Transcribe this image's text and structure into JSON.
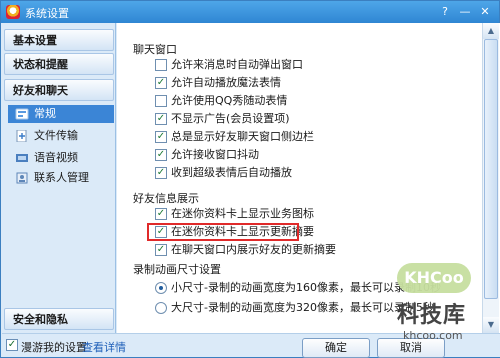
{
  "window": {
    "title": "系统设置"
  },
  "titlebar_buttons": {
    "help": "?",
    "minimize": "—",
    "close": "✕"
  },
  "sidebar": {
    "groups": [
      "基本设置",
      "状态和提醒",
      "好友和聊天",
      "安全和隐私"
    ],
    "items": [
      {
        "label": "常规",
        "icon": "gear-icon",
        "active": true
      },
      {
        "label": "文件传输",
        "icon": "file-transfer-icon",
        "active": false
      },
      {
        "label": "语音视频",
        "icon": "video-icon",
        "active": false
      },
      {
        "label": "联系人管理",
        "icon": "contacts-icon",
        "active": false
      }
    ]
  },
  "content": {
    "sections": [
      {
        "title": "聊天窗口",
        "options": [
          {
            "label": "允许来消息时自动弹出窗口",
            "checked": false
          },
          {
            "label": "允许自动播放魔法表情",
            "checked": true
          },
          {
            "label": "允许使用QQ秀随动表情",
            "checked": false
          },
          {
            "label": "不显示广告(会员设置项)",
            "checked": true
          },
          {
            "label": "总是显示好友聊天窗口侧边栏",
            "checked": true
          },
          {
            "label": "允许接收窗口抖动",
            "checked": true
          },
          {
            "label": "收到超级表情后自动播放",
            "checked": true
          }
        ]
      },
      {
        "title": "好友信息展示",
        "options": [
          {
            "label": "在迷你资料卡上显示业务图标",
            "checked": true
          },
          {
            "label": "在迷你资料卡上显示更新摘要",
            "checked": true
          },
          {
            "label": "在聊天窗口内展示好友的更新摘要",
            "checked": true
          }
        ]
      },
      {
        "title": "录制动画尺寸设置",
        "radios": [
          {
            "label": "小尺寸-录制的动画宽度为160像素，最长可以录制10秒",
            "selected": true
          },
          {
            "label": "大尺寸-录制的动画宽度为320像素，最长可以录制5秒",
            "selected": false
          }
        ]
      }
    ]
  },
  "bottom": {
    "roam_label": "漫游我的设置",
    "roam_checked": true,
    "details_link": "查看详情",
    "ok_label": "确定",
    "cancel_label": "取消"
  },
  "watermark": {
    "badge": "KHCoo",
    "name": "科技库",
    "url": "khcoo.com"
  },
  "colors": {
    "titlebar": "#2f86d3",
    "highlight": "#e02a2a",
    "active_item": "#3b85d6"
  }
}
